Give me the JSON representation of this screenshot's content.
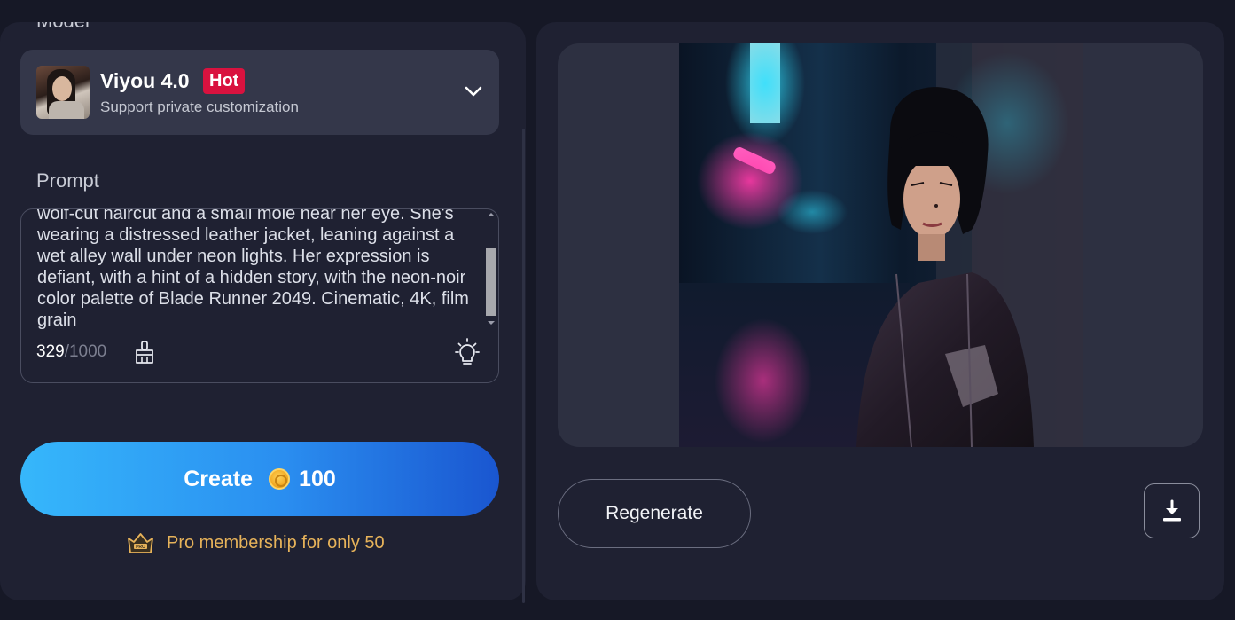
{
  "left_panel": {
    "model_section_label": "Model",
    "model": {
      "name": "Viyou 4.0",
      "badge": "Hot",
      "subtitle": "Support private customization"
    },
    "prompt_section_label": "Prompt",
    "prompt": {
      "text": "wolf-cut haircut and a small mole near her eye. She's wearing a distressed leather jacket, leaning against a wet alley wall under neon lights. Her expression is defiant, with a hint of a hidden story, with the neon-noir color palette of Blade Runner 2049. Cinematic, 4K, film grain",
      "char_count": "329",
      "separator": "/",
      "char_limit": "1000"
    },
    "create_button": {
      "label": "Create",
      "cost": "100"
    },
    "promo": {
      "text": "Pro membership for only 50"
    }
  },
  "right_panel": {
    "regenerate_label": "Regenerate"
  },
  "icons": {
    "model_chevron": "chevron-down-icon",
    "clear": "brush-icon",
    "inspire": "lightbulb-icon",
    "coin": "coin-icon",
    "crown": "pro-crown-icon",
    "download": "download-icon"
  },
  "colors": {
    "background": "#161826",
    "panel": "#1f2132",
    "hot_badge": "#d9123f",
    "create_gradient_start": "#36b7fb",
    "create_gradient_end": "#1a56d0",
    "promo_text": "#e7b35a"
  }
}
